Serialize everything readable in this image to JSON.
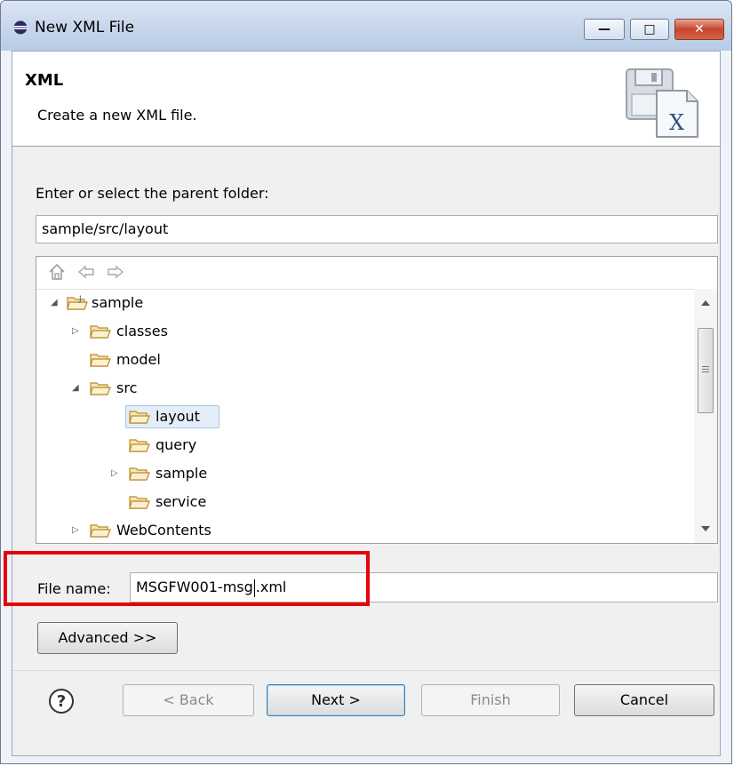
{
  "window": {
    "title": "New XML File"
  },
  "header": {
    "title": "XML",
    "description": "Create a new XML file."
  },
  "folder": {
    "label": "Enter or select the parent folder:",
    "value": "sample/src/layout"
  },
  "tree": {
    "items": [
      {
        "label": "sample",
        "expanded": true,
        "icon": "project-folder-icon"
      },
      {
        "label": "classes",
        "expanded": false,
        "icon": "folder-icon"
      },
      {
        "label": "model",
        "icon": "folder-icon"
      },
      {
        "label": "src",
        "expanded": true,
        "icon": "folder-icon"
      },
      {
        "label": "layout",
        "selected": true,
        "icon": "folder-icon"
      },
      {
        "label": "query",
        "icon": "folder-icon"
      },
      {
        "label": "sample",
        "expanded": false,
        "icon": "folder-icon"
      },
      {
        "label": "service",
        "icon": "folder-icon"
      },
      {
        "label": "WebContents",
        "expanded": false,
        "icon": "folder-icon"
      }
    ]
  },
  "file": {
    "label": "File name:",
    "value_before_caret": "MSGFW001-msg",
    "value_after_caret": ".xml"
  },
  "buttons": {
    "advanced": "Advanced >>",
    "back": "< Back",
    "next": "Next >",
    "finish": "Finish",
    "cancel": "Cancel"
  },
  "colors": {
    "highlight": "#e8000b",
    "accent": "#3c7fb1"
  }
}
